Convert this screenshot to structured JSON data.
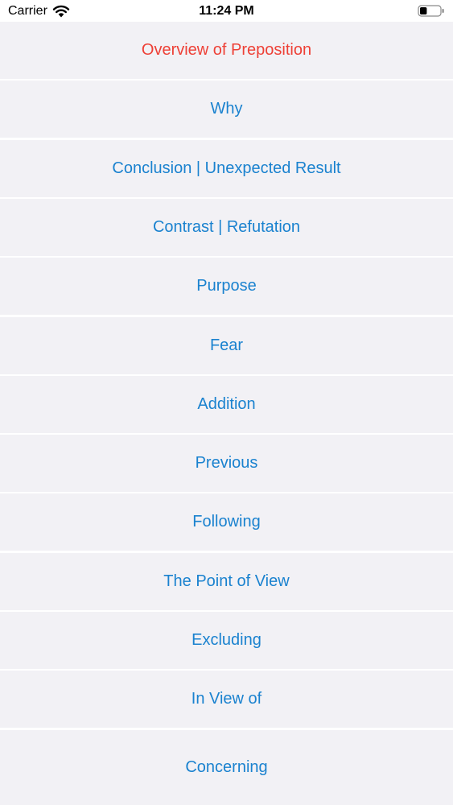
{
  "status_bar": {
    "carrier": "Carrier",
    "time": "11:24 PM",
    "battery_level": 0.35
  },
  "colors": {
    "link": "#1a82cf",
    "selected": "#ee4036",
    "row_background": "#f2f1f5",
    "separator": "#ffffff"
  },
  "menu": {
    "items": [
      {
        "label": "Overview of Preposition",
        "selected": true
      },
      {
        "label": "Why"
      },
      {
        "label": "Conclusion | Unexpected Result"
      },
      {
        "label": "Contrast | Refutation"
      },
      {
        "label": "Purpose"
      },
      {
        "label": "Fear"
      },
      {
        "label": "Addition"
      },
      {
        "label": "Previous"
      },
      {
        "label": "Following"
      },
      {
        "label": "The Point of View"
      },
      {
        "label": "Excluding"
      },
      {
        "label": "In View of"
      },
      {
        "label": "Concerning"
      }
    ]
  }
}
